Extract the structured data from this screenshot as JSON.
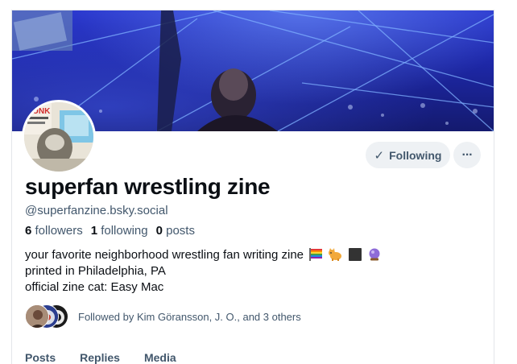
{
  "profile": {
    "display_name": "superfan wrestling zine",
    "handle": "@superfanzine.bsky.social",
    "stats": {
      "followers_count": "6",
      "followers_label": "followers",
      "following_count": "1",
      "following_label": "following",
      "posts_count": "0",
      "posts_label": "posts"
    },
    "bio": {
      "line1": "your favorite neighborhood wrestling fan writing zine",
      "line2": "printed in Philadelphia, PA",
      "line3": "official zine cat: Easy Mac"
    },
    "bio_emojis": [
      "rainbow-flag",
      "cat",
      "black-square",
      "crystal-ball"
    ]
  },
  "actions": {
    "following_label": "Following",
    "more_label": "···"
  },
  "followed_by": {
    "text": "Followed by Kim Göransson, J. O., and 3 others"
  },
  "tabs": [
    "Posts",
    "Replies",
    "Media"
  ],
  "colors": {
    "banner_blue": "#1d27a6",
    "text_secondary": "#42576c",
    "button_bg": "#eef1f4"
  }
}
